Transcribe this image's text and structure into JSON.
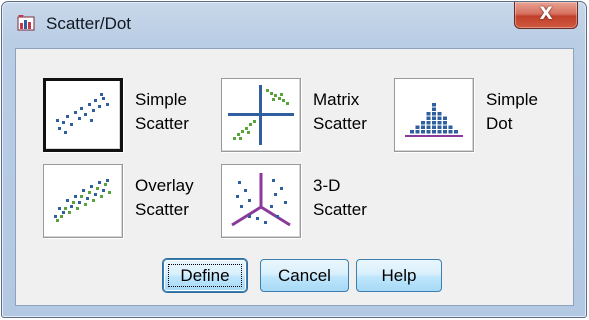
{
  "window": {
    "title": "Scatter/Dot",
    "close_label": "X",
    "icon": "spss-chart-icon"
  },
  "options": [
    {
      "line1": "Simple",
      "line2": "Scatter",
      "icon": "simple-scatter-icon",
      "selected": true
    },
    {
      "line1": "Matrix",
      "line2": "Scatter",
      "icon": "matrix-scatter-icon",
      "selected": false
    },
    {
      "line1": "Simple",
      "line2": "Dot",
      "icon": "simple-dot-icon",
      "selected": false
    },
    {
      "line1": "Overlay",
      "line2": "Scatter",
      "icon": "overlay-scatter-icon",
      "selected": false
    },
    {
      "line1": "3-D",
      "line2": "Scatter",
      "icon": "3d-scatter-icon",
      "selected": false
    }
  ],
  "buttons": {
    "define": "Define",
    "cancel": "Cancel",
    "help": "Help"
  },
  "colors": {
    "chart_blue": "#2f5f9e",
    "chart_green": "#5aa33a",
    "chart_purple": "#8a3a9a",
    "close_red": "#c2402b"
  }
}
